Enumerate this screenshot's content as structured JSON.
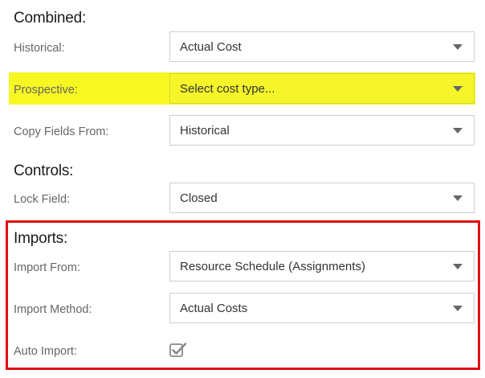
{
  "combined": {
    "title": "Combined:",
    "historical": {
      "label": "Historical:",
      "value": "Actual Cost"
    },
    "prospective": {
      "label": "Prospective:",
      "placeholder": "Select cost type...",
      "highlight_color": "#f7f722"
    },
    "copy_fields_from": {
      "label": "Copy Fields From:",
      "value": "Historical"
    }
  },
  "controls": {
    "title": "Controls:",
    "lock_field": {
      "label": "Lock Field:",
      "value": "Closed"
    }
  },
  "imports": {
    "title": "Imports:",
    "frame_color": "#e01010",
    "import_from": {
      "label": "Import From:",
      "value": "Resource Schedule (Assignments)"
    },
    "import_method": {
      "label": "Import Method:",
      "value": "Actual Costs"
    },
    "auto_import": {
      "label": "Auto Import:",
      "checked": true
    }
  },
  "icons": {
    "dropdown": "chevron-down-icon",
    "checkbox": "checkbox-checked-icon"
  }
}
